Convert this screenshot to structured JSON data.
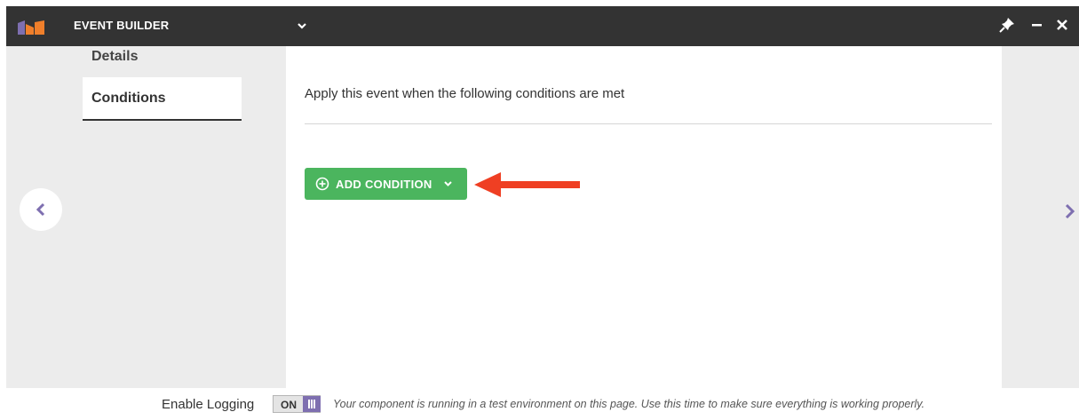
{
  "window": {
    "title": "EVENT BUILDER"
  },
  "sidebar": {
    "items": [
      {
        "label": "Details"
      },
      {
        "label": "Conditions"
      }
    ]
  },
  "main": {
    "heading": "Apply this event when the following conditions are met",
    "add_condition_label": "ADD CONDITION"
  },
  "footer": {
    "logging_label": "Enable Logging",
    "toggle_label": "ON",
    "message": "Your component is running in a test environment on this page. Use this time to make sure everything is working properly."
  },
  "icons": {
    "logo": "marketo-logo",
    "title_menu": "chevron-down-icon",
    "pin": "pin-icon",
    "minimize": "minimize-icon",
    "close": "close-icon",
    "add": "plus-circle-icon",
    "add_menu": "chevron-down-icon",
    "prev": "chevron-left-icon",
    "next": "chevron-right-icon",
    "toggle_knob": "toggle-grip-icon",
    "annotation": "arrow-left-icon"
  },
  "colors": {
    "titlebar": "#333333",
    "accent_purple": "#7e6fb0",
    "button_green": "#4bb55e",
    "annotation_red": "#ef3f23"
  }
}
